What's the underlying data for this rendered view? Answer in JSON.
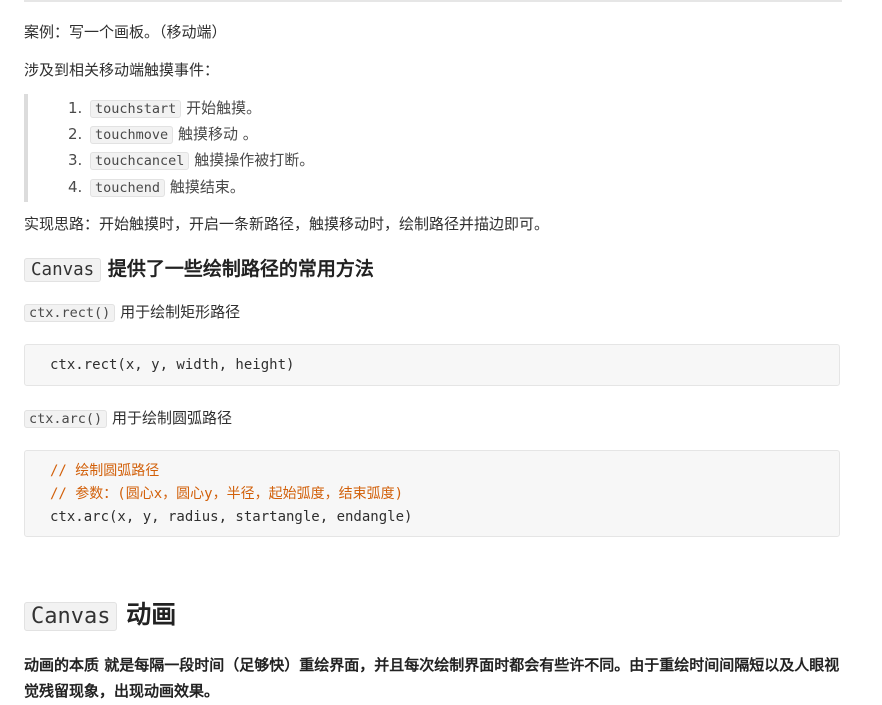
{
  "intro": {
    "case_line": "案例：写一个画板。（移动端）",
    "events_line": "涉及到相关移动端触摸事件："
  },
  "events": [
    {
      "num": "1.",
      "code": "touchstart",
      "text": "开始触摸。"
    },
    {
      "num": "2.",
      "code": "touchmove",
      "text": "触摸移动 。"
    },
    {
      "num": "3.",
      "code": "touchcancel",
      "text": "触摸操作被打断。"
    },
    {
      "num": "4.",
      "code": "touchend",
      "text": "触摸结束。"
    }
  ],
  "idea_line": "实现思路：开始触摸时，开启一条新路径，触摸移动时，绘制路径并描边即可。",
  "section_paths": {
    "code": "Canvas",
    "title": "提供了一些绘制路径的常用方法"
  },
  "rect": {
    "code": "ctx.rect()",
    "desc": "用于绘制矩形路径",
    "block": "ctx.rect(x, y, width, height)"
  },
  "arc": {
    "code": "ctx.arc()",
    "desc": "用于绘制圆弧路径",
    "comment1": "// 绘制圆弧路径",
    "comment2": "// 参数：(圆心x，圆心y，半径，起始弧度，结束弧度)",
    "block": "ctx.arc(x, y, radius, startangle, endangle)"
  },
  "section_anim": {
    "code": "Canvas",
    "title": "动画"
  },
  "anim_desc": "动画的本质 就是每隔一段时间（足够快）重绘界面，并且每次绘制界面时都会有些许不同。由于重绘时间间隔短以及人眼视觉残留现象，出现动画效果。"
}
